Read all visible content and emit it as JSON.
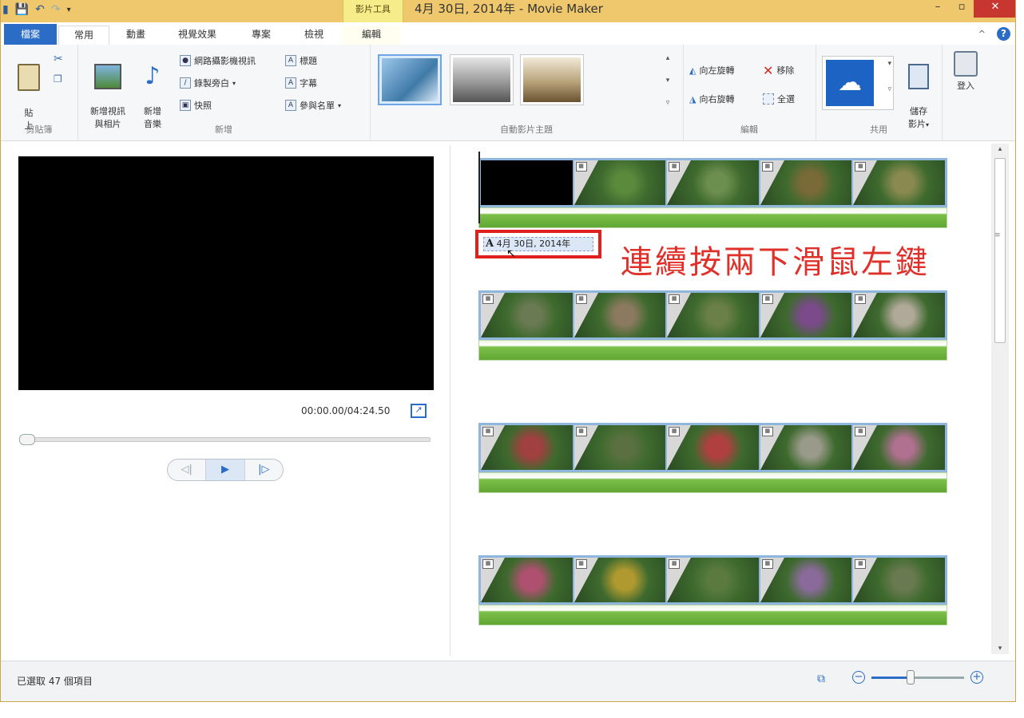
{
  "window": {
    "title": "4月 30日, 2014年 - Movie Maker",
    "context_tab": "影片工具"
  },
  "tabs": {
    "file": "檔案",
    "items": [
      "常用",
      "動畫",
      "視覺效果",
      "專案",
      "檢視",
      "編輯"
    ]
  },
  "ribbon": {
    "clipboard": {
      "label": "剪貼簿",
      "paste": "貼\n上"
    },
    "add": {
      "label": "新增",
      "add_video_photo": "新增視訊\n與相片",
      "add_music": "新增\n音樂",
      "webcam": "網路攝影機視訊",
      "narration": "錄製旁白",
      "snapshot": "快照",
      "title": "標題",
      "caption": "字幕",
      "credits": "參與名單"
    },
    "themes": {
      "label": "自動影片主題"
    },
    "edit": {
      "label": "編輯",
      "rotate_left": "向左旋轉",
      "rotate_right": "向右旋轉",
      "remove": "移除",
      "select_all": "全選"
    },
    "share": {
      "label": "共用",
      "save_movie": "儲存\n影片",
      "sign_in": "登入"
    }
  },
  "preview": {
    "timecode": "00:00.00/04:24.50"
  },
  "storyboard": {
    "caption_text": "4月 30日, 2014年",
    "annotation": "連續按兩下滑鼠左鍵",
    "tracks": [
      [
        "#000000",
        "#5a8a3c",
        "#6c8e4e",
        "#7a6a38",
        "#8a8a50"
      ],
      [
        "#6a7a52",
        "#8c7a60",
        "#6a8048",
        "#7a4a8a",
        "#b0a898"
      ],
      [
        "#a04040",
        "#5a7040",
        "#b04040",
        "#9a9a8a",
        "#b07090"
      ],
      [
        "#b05070",
        "#b09a30",
        "#5a7a40",
        "#8a6a9a",
        "#6a7a50"
      ]
    ]
  },
  "status": {
    "selected": "已選取 47 個項目"
  },
  "colors": {
    "title_bar": "#efc86e",
    "accent": "#2b6cc7",
    "annotation": "#e0302a"
  }
}
